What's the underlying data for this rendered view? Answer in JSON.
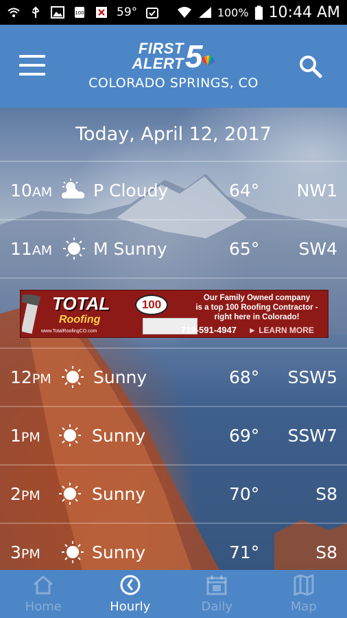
{
  "status_bar": {
    "temperature": "59°",
    "battery_percent": "100%",
    "time": "10:44 AM"
  },
  "header": {
    "logo_line1": "FIRST",
    "logo_line2": "ALERT",
    "logo_number": "5",
    "location": "COLORADO SPRINGS, CO"
  },
  "forecast": {
    "date": "Today, April 12, 2017",
    "hours": [
      {
        "hour": "10",
        "ampm": "AM",
        "icon": "partly-cloudy-icon",
        "condition": "P Cloudy",
        "temp": "64°",
        "wind": "NW1"
      },
      {
        "hour": "11",
        "ampm": "AM",
        "icon": "mostly-sunny-icon",
        "condition": "M Sunny",
        "temp": "65°",
        "wind": "SW4"
      },
      {
        "hour": "12",
        "ampm": "PM",
        "icon": "sun-icon",
        "condition": "Sunny",
        "temp": "68°",
        "wind": "SSW5"
      },
      {
        "hour": "1",
        "ampm": "PM",
        "icon": "sun-icon",
        "condition": "Sunny",
        "temp": "69°",
        "wind": "SSW7"
      },
      {
        "hour": "2",
        "ampm": "PM",
        "icon": "sun-icon",
        "condition": "Sunny",
        "temp": "70°",
        "wind": "S8"
      },
      {
        "hour": "3",
        "ampm": "PM",
        "icon": "sun-icon",
        "condition": "Sunny",
        "temp": "71°",
        "wind": "S8"
      }
    ]
  },
  "ad": {
    "brand_line1": "TOTAL",
    "brand_line2": "Roofing",
    "badge": "100",
    "website": "www.TotalRoofingCO.com",
    "headline_1": "Our Family Owned company",
    "headline_2": "is a top 100 Roofing Contractor -",
    "headline_3": "right here in Colorado!",
    "phone": "719-591-4947",
    "cta": "► LEARN MORE"
  },
  "nav": {
    "items": [
      {
        "label": "Home",
        "icon": "home-icon",
        "active": false
      },
      {
        "label": "Hourly",
        "icon": "clock-icon",
        "active": true
      },
      {
        "label": "Daily",
        "icon": "calendar-icon",
        "active": false
      },
      {
        "label": "Map",
        "icon": "map-icon",
        "active": false
      }
    ]
  },
  "colors": {
    "header_blue": "#4d86c6",
    "ad_red": "#8e1a17",
    "status_bar": "#000000"
  }
}
